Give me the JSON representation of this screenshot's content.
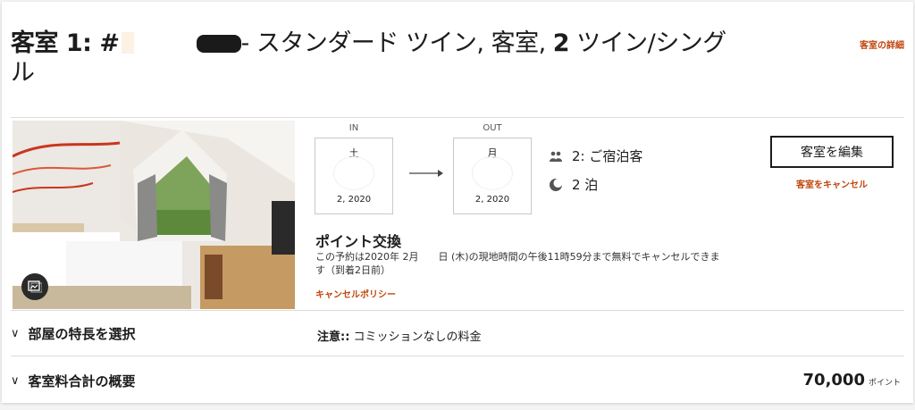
{
  "header": {
    "title_prefix": "客室 1: #",
    "title_suffix": "- スタンダード ツイン, 客室, ",
    "title_bold_count": "2",
    "title_tail": " ツイン/シング",
    "title_line2": "ル",
    "details_link": "客室の詳細"
  },
  "stay": {
    "in_label": "IN",
    "in_dow": "土",
    "in_year": "2, 2020",
    "out_label": "OUT",
    "out_dow": "月",
    "out_year": "2, 2020",
    "guests": "2: ご宿泊客",
    "nights": "2 泊"
  },
  "actions": {
    "edit_room": "客室を編集",
    "cancel_room": "客室をキャンセル"
  },
  "rate": {
    "heading": "ポイント交換",
    "policy_line1": "この予約は2020年 2月　　日 (木)の現地時間の午後11時59分まで無料でキャンセルできま",
    "policy_line2": "す（到着2日前）",
    "policy_link": "キャンセルポリシー"
  },
  "features": {
    "label": "部屋の特長を選択",
    "note_label": "注意::",
    "note_text": " コミッションなしの料金"
  },
  "summary": {
    "label": "客室料合計の概要",
    "total": "70,000",
    "unit": "ポイント"
  },
  "icons": {
    "photo_gallery": "gallery-icon",
    "guests": "people-icon",
    "nights": "moon-icon",
    "expand": "chevron-down-icon"
  },
  "colors": {
    "accent": "#c0460d",
    "text": "#1c1c1c"
  }
}
